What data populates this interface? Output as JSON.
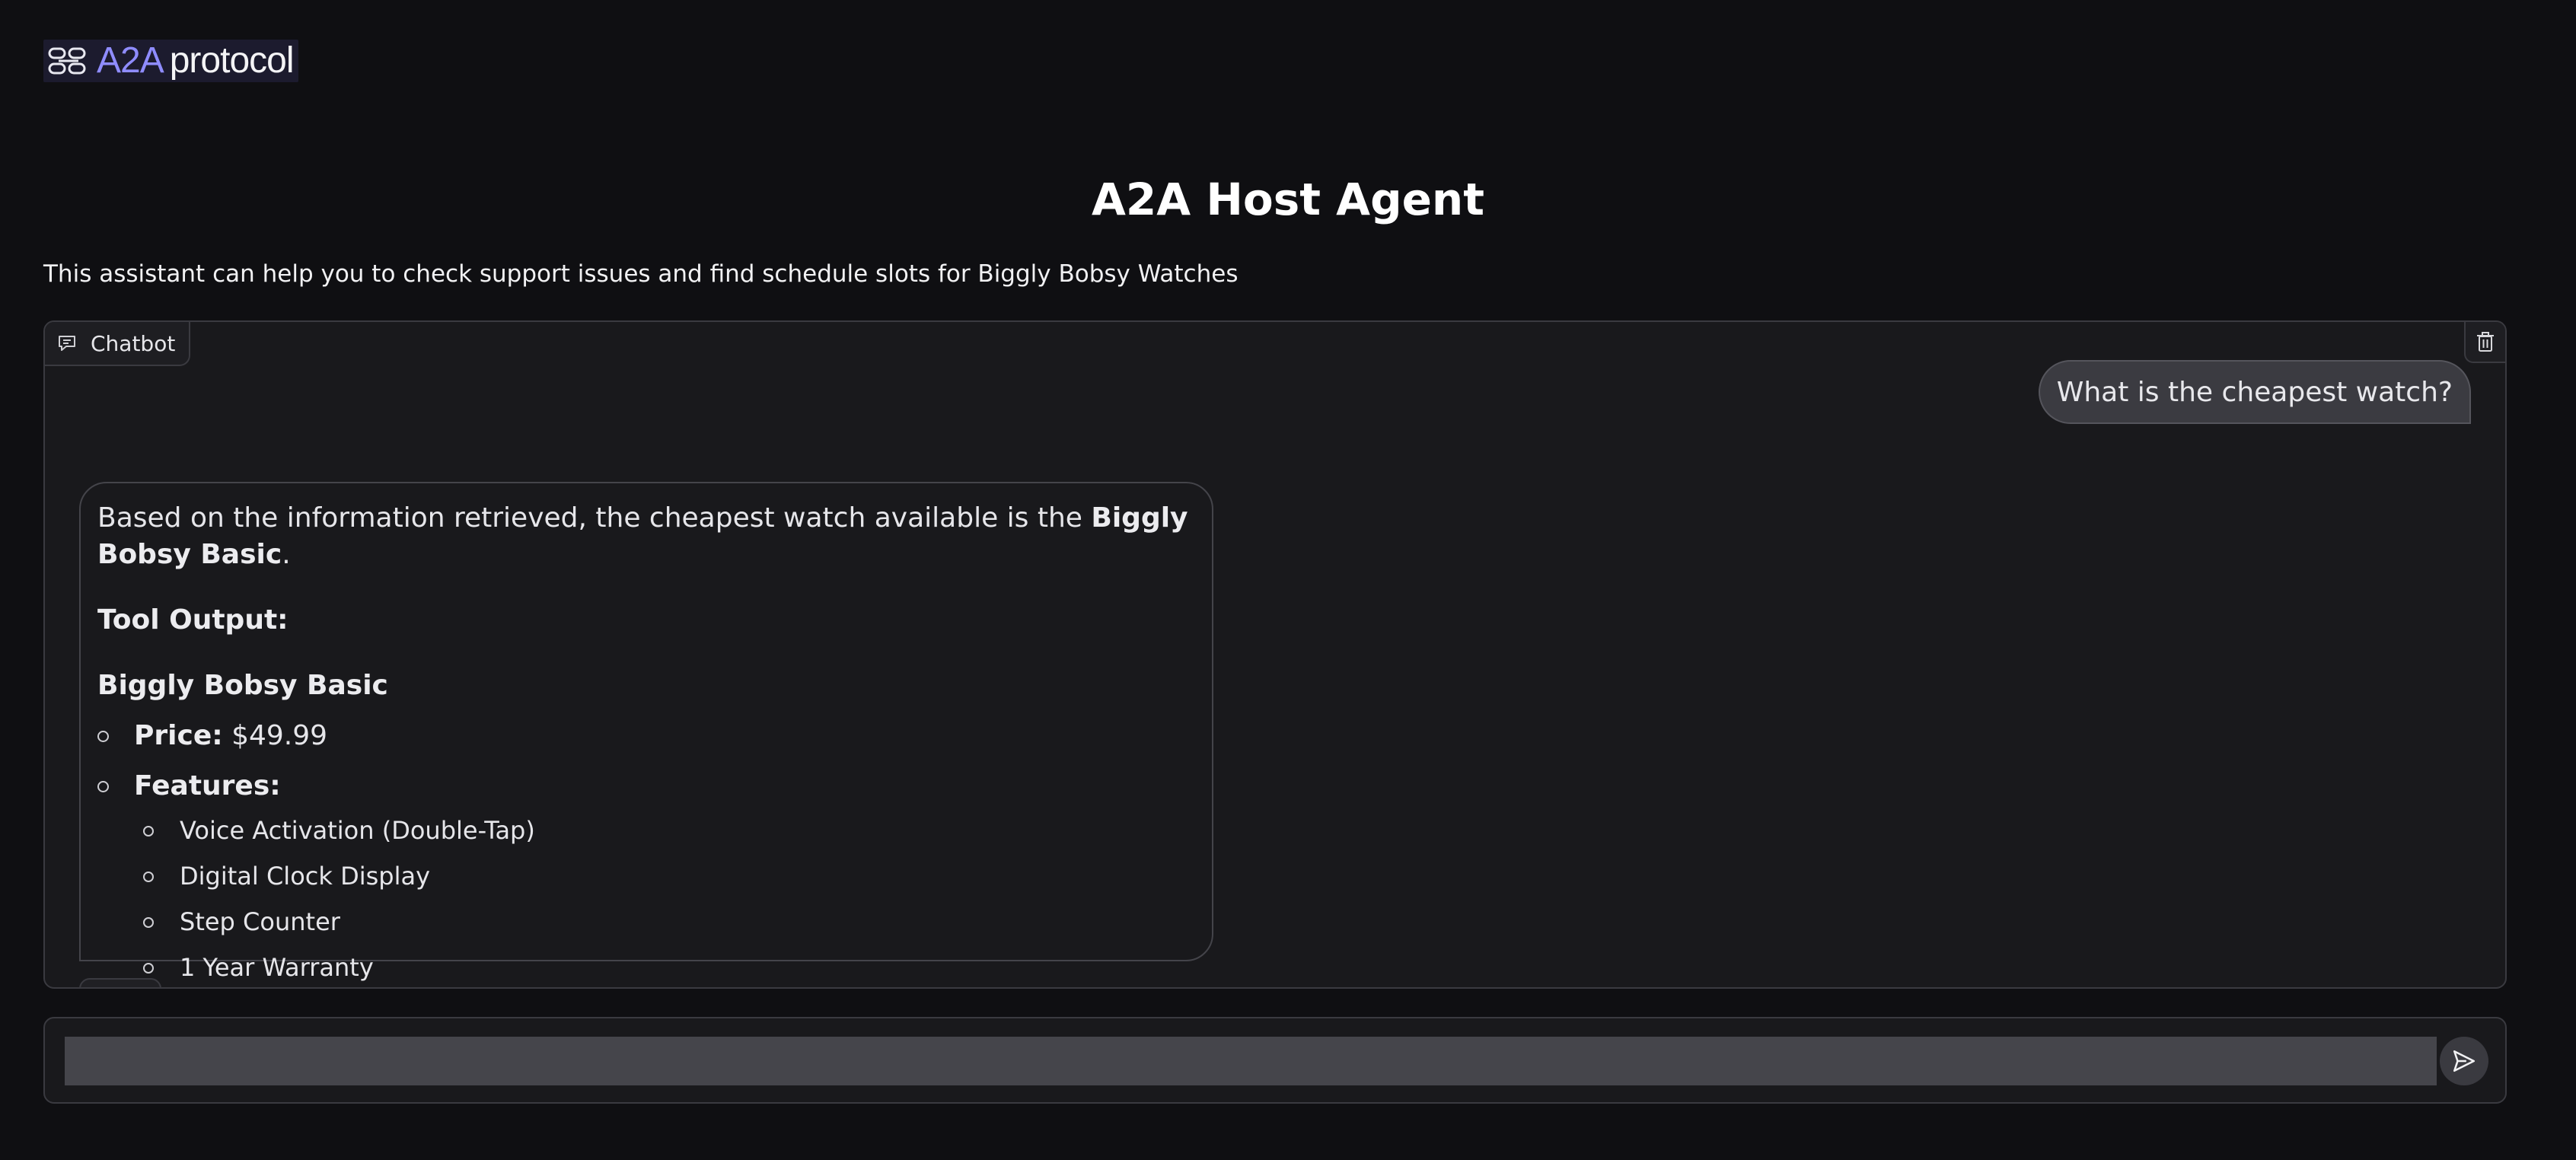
{
  "header": {
    "logo_a2a": "A2A",
    "logo_protocol": "protocol",
    "title": "A2A Host Agent",
    "description": "This assistant can help you to check support issues and find schedule slots for Biggly Bobsy Watches"
  },
  "chat": {
    "label": "Chatbot",
    "user_message": "What is the cheapest watch?",
    "bot": {
      "intro_prefix": "Based on the information retrieved, the cheapest watch available is the ",
      "intro_bold": "Biggly Bobsy Basic",
      "intro_suffix": ".",
      "tool_output_heading": "Tool Output:",
      "product_name": "Biggly Bobsy Basic",
      "price_label": "Price:",
      "price_value": " $49.99",
      "features_label": "Features:",
      "features": [
        "Voice Activation (Double-Tap)",
        "Digital Clock Display",
        "Step Counter",
        "1 Year Warranty"
      ]
    }
  },
  "input": {
    "placeholder": "",
    "value": ""
  },
  "icons": {
    "chat": "chat-bubble-icon",
    "clear": "trash-icon",
    "send": "send-icon"
  }
}
